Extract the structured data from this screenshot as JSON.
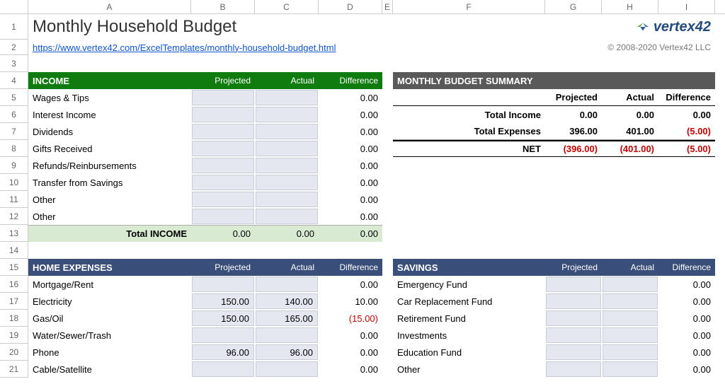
{
  "columns": [
    "",
    "A",
    "B",
    "C",
    "D",
    "E",
    "F",
    "G",
    "H",
    "I"
  ],
  "rows": [
    "1",
    "2",
    "3",
    "4",
    "5",
    "6",
    "7",
    "8",
    "9",
    "10",
    "11",
    "12",
    "13",
    "14",
    "15",
    "16",
    "17",
    "18",
    "19",
    "20",
    "21"
  ],
  "title": "Monthly Household Budget",
  "link_text": "https://www.vertex42.com/ExcelTemplates/monthly-household-budget.html",
  "logo_text": "vertex42",
  "copyright": "© 2008-2020 Vertex42 LLC",
  "labels": {
    "projected": "Projected",
    "actual": "Actual",
    "difference": "Difference"
  },
  "income": {
    "title": "INCOME",
    "items": [
      {
        "name": "Wages & Tips",
        "projected": "",
        "actual": "",
        "diff": "0.00"
      },
      {
        "name": "Interest Income",
        "projected": "",
        "actual": "",
        "diff": "0.00"
      },
      {
        "name": "Dividends",
        "projected": "",
        "actual": "",
        "diff": "0.00"
      },
      {
        "name": "Gifts Received",
        "projected": "",
        "actual": "",
        "diff": "0.00"
      },
      {
        "name": "Refunds/Reinbursements",
        "projected": "",
        "actual": "",
        "diff": "0.00"
      },
      {
        "name": "Transfer from Savings",
        "projected": "",
        "actual": "",
        "diff": "0.00"
      },
      {
        "name": "Other",
        "projected": "",
        "actual": "",
        "diff": "0.00"
      },
      {
        "name": "Other",
        "projected": "",
        "actual": "",
        "diff": "0.00"
      }
    ],
    "total_label": "Total INCOME",
    "total": {
      "projected": "0.00",
      "actual": "0.00",
      "diff": "0.00"
    }
  },
  "summary": {
    "title": "MONTHLY BUDGET SUMMARY",
    "rows": [
      {
        "label": "Total Income",
        "projected": "0.00",
        "actual": "0.00",
        "diff": "0.00",
        "neg": [
          false,
          false,
          false
        ]
      },
      {
        "label": "Total Expenses",
        "projected": "396.00",
        "actual": "401.00",
        "diff": "(5.00)",
        "neg": [
          false,
          false,
          true
        ]
      },
      {
        "label": "NET",
        "projected": "(396.00)",
        "actual": "(401.00)",
        "diff": "(5.00)",
        "neg": [
          true,
          true,
          true
        ]
      }
    ]
  },
  "home_expenses": {
    "title": "HOME EXPENSES",
    "items": [
      {
        "name": "Mortgage/Rent",
        "projected": "",
        "actual": "",
        "diff": "0.00"
      },
      {
        "name": "Electricity",
        "projected": "150.00",
        "actual": "140.00",
        "diff": "10.00"
      },
      {
        "name": "Gas/Oil",
        "projected": "150.00",
        "actual": "165.00",
        "diff": "(15.00)",
        "neg": true
      },
      {
        "name": "Water/Sewer/Trash",
        "projected": "",
        "actual": "",
        "diff": "0.00"
      },
      {
        "name": "Phone",
        "projected": "96.00",
        "actual": "96.00",
        "diff": "0.00"
      },
      {
        "name": "Cable/Satellite",
        "projected": "",
        "actual": "",
        "diff": "0.00"
      }
    ]
  },
  "savings": {
    "title": "SAVINGS",
    "items": [
      {
        "name": "Emergency Fund",
        "diff": "0.00"
      },
      {
        "name": "Car Replacement Fund",
        "diff": "0.00"
      },
      {
        "name": "Retirement Fund",
        "diff": "0.00"
      },
      {
        "name": "Investments",
        "diff": "0.00"
      },
      {
        "name": "Education Fund",
        "diff": "0.00"
      },
      {
        "name": "Other",
        "diff": "0.00"
      }
    ]
  },
  "chart_data": {
    "type": "table",
    "title": "Monthly Household Budget",
    "sections": {
      "income": {
        "columns": [
          "Item",
          "Projected",
          "Actual",
          "Difference"
        ],
        "rows": [
          [
            "Wages & Tips",
            null,
            null,
            0.0
          ],
          [
            "Interest Income",
            null,
            null,
            0.0
          ],
          [
            "Dividends",
            null,
            null,
            0.0
          ],
          [
            "Gifts Received",
            null,
            null,
            0.0
          ],
          [
            "Refunds/Reinbursements",
            null,
            null,
            0.0
          ],
          [
            "Transfer from Savings",
            null,
            null,
            0.0
          ],
          [
            "Other",
            null,
            null,
            0.0
          ],
          [
            "Other",
            null,
            null,
            0.0
          ]
        ],
        "total": [
          "Total INCOME",
          0.0,
          0.0,
          0.0
        ]
      },
      "summary": {
        "columns": [
          "",
          "Projected",
          "Actual",
          "Difference"
        ],
        "rows": [
          [
            "Total Income",
            0.0,
            0.0,
            0.0
          ],
          [
            "Total Expenses",
            396.0,
            401.0,
            -5.0
          ],
          [
            "NET",
            -396.0,
            -401.0,
            -5.0
          ]
        ]
      },
      "home_expenses": {
        "columns": [
          "Item",
          "Projected",
          "Actual",
          "Difference"
        ],
        "rows": [
          [
            "Mortgage/Rent",
            null,
            null,
            0.0
          ],
          [
            "Electricity",
            150.0,
            140.0,
            10.0
          ],
          [
            "Gas/Oil",
            150.0,
            165.0,
            -15.0
          ],
          [
            "Water/Sewer/Trash",
            null,
            null,
            0.0
          ],
          [
            "Phone",
            96.0,
            96.0,
            0.0
          ],
          [
            "Cable/Satellite",
            null,
            null,
            0.0
          ]
        ]
      },
      "savings": {
        "columns": [
          "Item",
          "Projected",
          "Actual",
          "Difference"
        ],
        "rows": [
          [
            "Emergency Fund",
            null,
            null,
            0.0
          ],
          [
            "Car Replacement Fund",
            null,
            null,
            0.0
          ],
          [
            "Retirement Fund",
            null,
            null,
            0.0
          ],
          [
            "Investments",
            null,
            null,
            0.0
          ],
          [
            "Education Fund",
            null,
            null,
            0.0
          ],
          [
            "Other",
            null,
            null,
            0.0
          ]
        ]
      }
    }
  }
}
